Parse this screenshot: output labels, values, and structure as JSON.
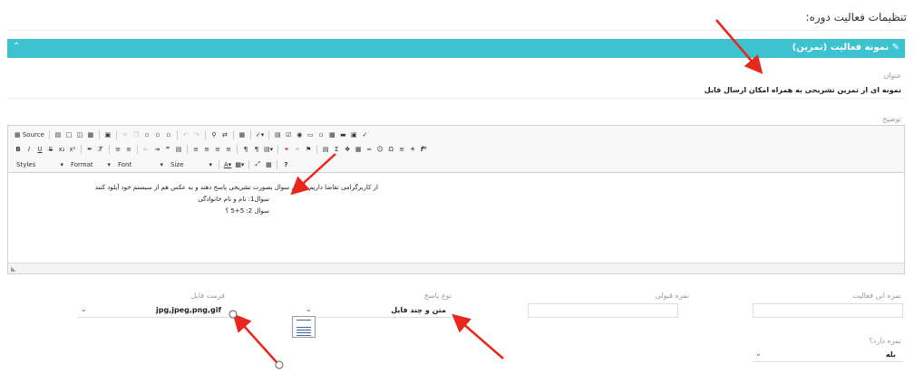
{
  "page": {
    "title": "تنظیمات فعالیت دوره:"
  },
  "panel": {
    "title": "نمونه فعالیت (تمرین)",
    "title_icon": "edit-icon",
    "collapse_icon": "chevron-up-icon"
  },
  "fields": {
    "title_label": "عنوان",
    "title_value": "نمونه ای از تمرین تشریحی به همراه امکان ارسال فایل",
    "description_label": "توضیح",
    "activity_grade_label": "نمره این فعالیت",
    "pass_grade_label": "نمره قبولی",
    "answer_type_label": "نوع پاسخ",
    "answer_type_value": "متن و چند فایل",
    "file_format_label": "فرمت فایل",
    "file_format_value": "jpg,jpeg,png,gif",
    "has_grade_label": "نمره دارد؟",
    "has_grade_value": "بله"
  },
  "editor": {
    "source_label": "Source",
    "styles_label": "Styles",
    "format_label": "Format",
    "font_label": "Font",
    "size_label": "Size",
    "content_lines": [
      "از کاربرگرامی تقاضا داریم به این سوال بصورت تشریحی پاسخ دهند و یه عکس هم از سیستم خود آپلود کنند",
      "سوال1: نام و نام خانوادگی",
      "سوال 2: 5+5 ؟"
    ],
    "resize_glyph": "◣"
  },
  "colors": {
    "accent": "#3cc3cf",
    "arrow": "#e8261b"
  }
}
